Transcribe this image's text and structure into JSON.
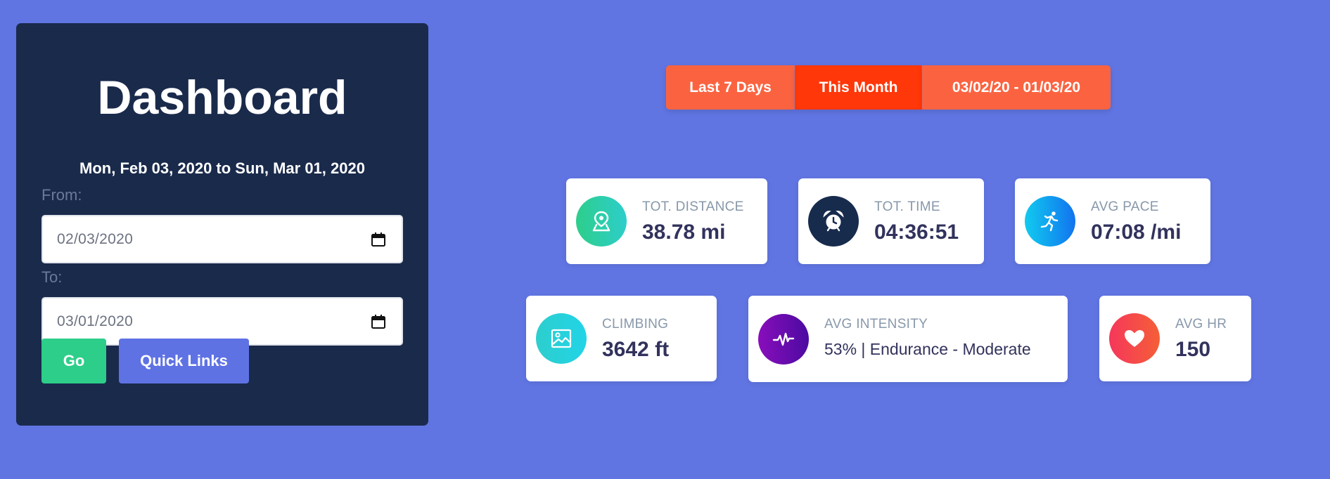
{
  "sidebar": {
    "title": "Dashboard",
    "range_text": "Mon, Feb 03, 2020 to Sun, Mar 01, 2020",
    "from_label": "From:",
    "from_value": "02/03/2020",
    "to_label": "To:",
    "to_value": "03/01/2020",
    "go_label": "Go",
    "quick_links_label": "Quick Links"
  },
  "range_tabs": [
    {
      "label": "Last 7 Days"
    },
    {
      "label": "This Month",
      "selected": true
    },
    {
      "label": "03/02/20 - 01/03/20"
    }
  ],
  "stats": {
    "distance": {
      "label": "TOT. DISTANCE",
      "value": "38.78 mi",
      "icon": "map-pin-icon"
    },
    "time": {
      "label": "TOT. TIME",
      "value": "04:36:51",
      "icon": "alarm-clock-icon"
    },
    "pace": {
      "label": "AVG PACE",
      "value": "07:08 /mi",
      "icon": "running-icon"
    },
    "climbing": {
      "label": "CLIMBING",
      "value": "3642 ft",
      "icon": "image-icon"
    },
    "intensity": {
      "label": "AVG INTENSITY",
      "value": "53% | Endurance - Moderate",
      "icon": "activity-icon"
    },
    "hr": {
      "label": "AVG HR",
      "value": "150",
      "icon": "heart-icon"
    }
  },
  "colors": {
    "background": "#6075e2",
    "panel": "#1a2a4b",
    "go": "#2dce89",
    "quick_links": "#5e72e4",
    "tab": "#fb6340",
    "tab_active": "#ff3709"
  }
}
